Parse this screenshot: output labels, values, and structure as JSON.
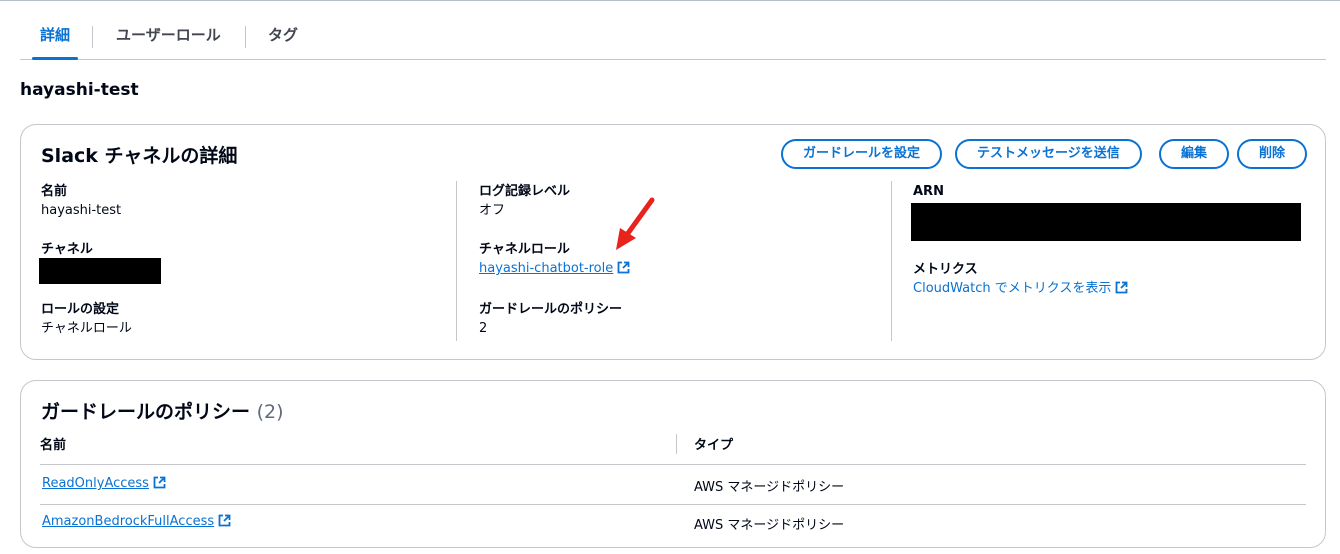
{
  "tabs": [
    {
      "label": "詳細",
      "active": true
    },
    {
      "label": "ユーザーロール",
      "active": false
    },
    {
      "label": "タグ",
      "active": false
    }
  ],
  "resource_title": "hayashi-test",
  "details": {
    "title": "Slack チャネルの詳細",
    "buttons": {
      "guardrail": "ガードレールを設定",
      "test_message": "テストメッセージを送信",
      "edit": "編集",
      "delete": "削除"
    },
    "name_label": "名前",
    "name_value": "hayashi-test",
    "channel_label": "チャネル",
    "role_setting_label": "ロールの設定",
    "role_setting_value": "チャネルロール",
    "log_level_label": "ログ記録レベル",
    "log_level_value": "オフ",
    "channel_role_label": "チャネルロール",
    "channel_role_value": "hayashi-chatbot-role",
    "guardrail_policy_label": "ガードレールのポリシー",
    "guardrail_policy_value": "2",
    "arn_label": "ARN",
    "metrics_label": "メトリクス",
    "metrics_link": "CloudWatch でメトリクスを表示"
  },
  "policies": {
    "title": "ガードレールのポリシー",
    "count": "(2)",
    "columns": [
      "名前",
      "タイプ"
    ],
    "rows": [
      {
        "name": "ReadOnlyAccess",
        "type": "AWS マネージドポリシー"
      },
      {
        "name": "AmazonBedrockFullAccess",
        "type": "AWS マネージドポリシー"
      }
    ]
  },
  "colors": {
    "accent": "#0972d3",
    "arrow": "#e8231c",
    "redaction": "#000000"
  }
}
